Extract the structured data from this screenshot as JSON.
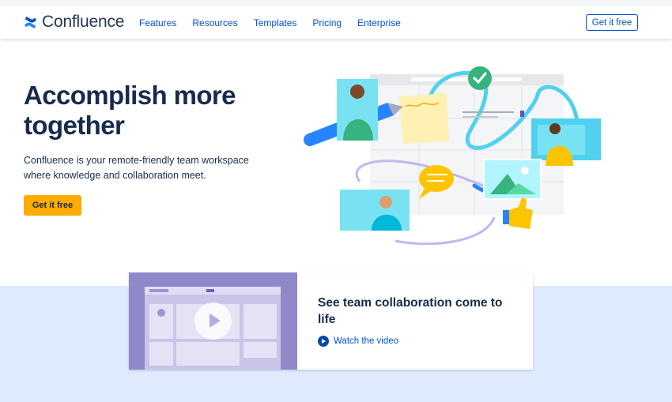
{
  "brand": {
    "name": "Confluence"
  },
  "nav": {
    "links": [
      "Features",
      "Resources",
      "Templates",
      "Pricing",
      "Enterprise"
    ],
    "cta": "Get it free"
  },
  "hero": {
    "title": "Accomplish more together",
    "subtitle": "Confluence is your remote-friendly team workspace where knowledge and collaboration meet.",
    "cta": "Get it free"
  },
  "video": {
    "title": "See team collaboration come to life",
    "link": "Watch the video"
  },
  "colors": {
    "brand_blue": "#0052CC",
    "cta_yellow": "#FFAB00",
    "text_dark": "#172B4D",
    "band_bg": "#DEEBFF"
  }
}
